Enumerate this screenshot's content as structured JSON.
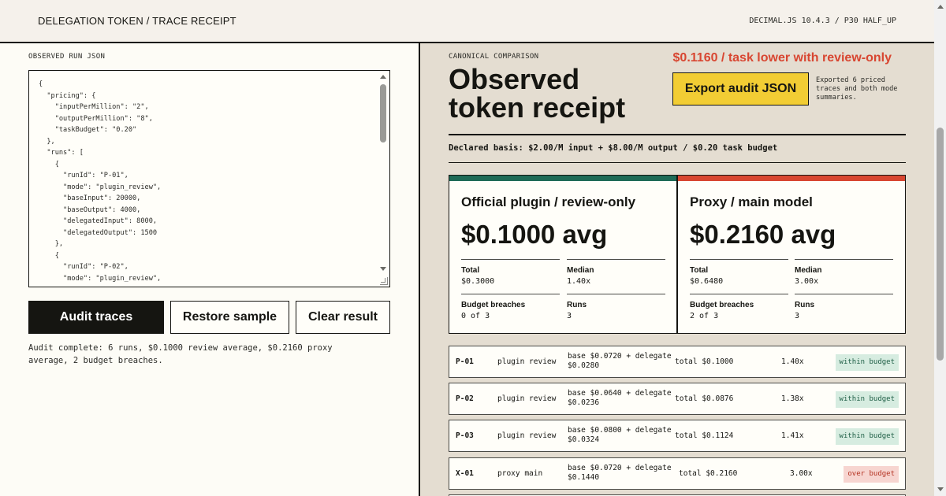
{
  "header": {
    "title": "DELEGATION TOKEN / TRACE RECEIPT",
    "version": "DECIMAL.JS 10.4.3 / P30 HALF_UP"
  },
  "left": {
    "label": "OBSERVED RUN JSON",
    "editor_text": "{\n  \"pricing\": {\n    \"inputPerMillion\": \"2\",\n    \"outputPerMillion\": \"8\",\n    \"taskBudget\": \"0.20\"\n  },\n  \"runs\": [\n    {\n      \"runId\": \"P-01\",\n      \"mode\": \"plugin_review\",\n      \"baseInput\": 20000,\n      \"baseOutput\": 4000,\n      \"delegatedInput\": 8000,\n      \"delegatedOutput\": 1500\n    },\n    {\n      \"runId\": \"P-02\",\n      \"mode\": \"plugin_review\",",
    "buttons": {
      "audit": "Audit traces",
      "restore": "Restore sample",
      "clear": "Clear result"
    },
    "status": "Audit complete: 6 runs, $0.1000 review average, $0.2160 proxy average, 2 budget breaches."
  },
  "right": {
    "eyebrow": "CANONICAL COMPARISON",
    "heading": "Observed token receipt",
    "savings": "$0.1160 / task lower with review-only",
    "export_label": "Export audit JSON",
    "export_note": "Exported 6 priced traces and both mode summaries.",
    "basis": "Declared basis: $2.00/M input + $8.00/M output / $0.20 task budget"
  },
  "cards": [
    {
      "title": "Official plugin / review-only",
      "avg": "$0.1000 avg",
      "accent": "#1f6b57",
      "total_label": "Total",
      "total_value": "$0.3000",
      "median_label": "Median",
      "median_value": "1.40x",
      "breach_label": "Budget breaches",
      "breach_value": "0 of 3",
      "runs_label": "Runs",
      "runs_value": "3"
    },
    {
      "title": "Proxy / main model",
      "avg": "$0.2160 avg",
      "accent": "#d84631",
      "total_label": "Total",
      "total_value": "$0.6480",
      "median_label": "Median",
      "median_value": "3.00x",
      "breach_label": "Budget breaches",
      "breach_value": "2 of 3",
      "runs_label": "Runs",
      "runs_value": "3"
    }
  ],
  "rows": [
    {
      "id": "P-01",
      "mode": "plugin review",
      "detail": "base $0.0720 + delegate $0.0280",
      "total": "total $0.1000",
      "ratio": "1.40x",
      "badge": "within budget",
      "status": "ok"
    },
    {
      "id": "P-02",
      "mode": "plugin review",
      "detail": "base $0.0640 + delegate $0.0236",
      "total": "total $0.0876",
      "ratio": "1.38x",
      "badge": "within budget",
      "status": "ok"
    },
    {
      "id": "P-03",
      "mode": "plugin review",
      "detail": "base $0.0800 + delegate $0.0324",
      "total": "total $0.1124",
      "ratio": "1.41x",
      "badge": "within budget",
      "status": "ok"
    },
    {
      "id": "X-01",
      "mode": "proxy main",
      "detail": "base $0.0720 + delegate $0.1440",
      "total": "total $0.2160",
      "ratio": "3.00x",
      "badge": "over budget",
      "status": "bad"
    }
  ]
}
